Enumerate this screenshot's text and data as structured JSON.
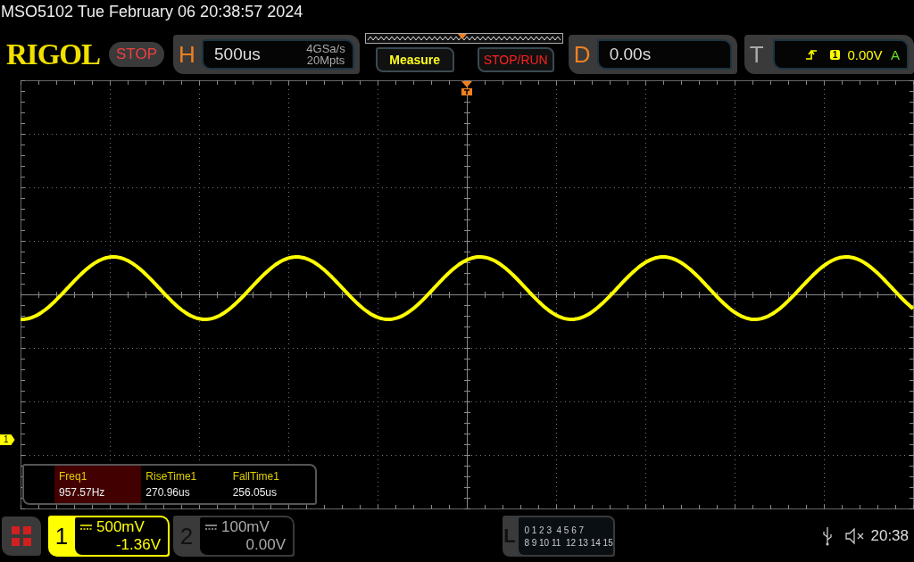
{
  "title_bar": {
    "model": "MSO5102",
    "datetime": "Tue February 06 20:38:57 2024"
  },
  "brand": "RIGOL",
  "run_state": {
    "label": "STOP",
    "kind": "stop"
  },
  "horizontal": {
    "label": "H",
    "timebase": "500us",
    "sample_rate": "4GSa/s",
    "memory_depth": "20Mpts"
  },
  "buttons": [
    {
      "label": "Measure",
      "kind": "measure"
    },
    {
      "label": "STOP/RUN",
      "kind": "stoprun"
    }
  ],
  "delay": {
    "label": "D",
    "value": "0.00s"
  },
  "trigger": {
    "label": "T",
    "source": "1",
    "level": "0.00V",
    "mode": "A"
  },
  "channel_marker": {
    "label": "1"
  },
  "measurements": [
    {
      "name": "Freq1",
      "value": "957.57Hz",
      "selected": true
    },
    {
      "name": "RiseTime1",
      "value": "270.96us",
      "selected": false
    },
    {
      "name": "FallTime1",
      "value": "256.05us",
      "selected": false
    }
  ],
  "channels": [
    {
      "number": "1",
      "scale": "500mV",
      "offset": "-1.36V",
      "enabled": true
    },
    {
      "number": "2",
      "scale": "100mV",
      "offset": "0.00V",
      "enabled": false
    }
  ],
  "logic": {
    "label": "L",
    "row_1": "0 1 2 3  4 5 6 7",
    "row_2": "8 9 10 11  12 13 14 15"
  },
  "status": {
    "time": "20:38"
  }
}
